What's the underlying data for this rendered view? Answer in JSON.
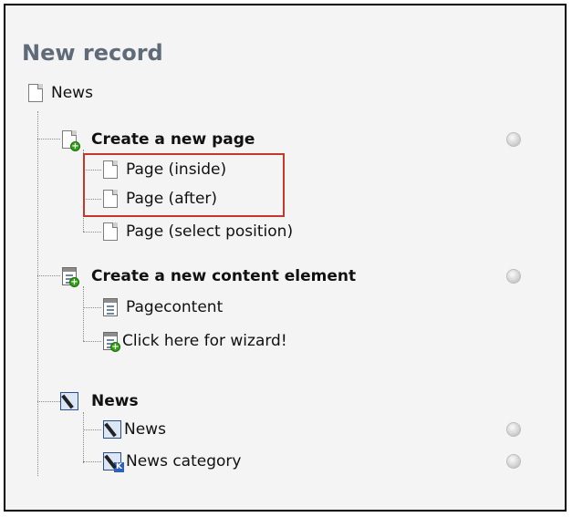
{
  "title": "New record",
  "root": {
    "label": "News",
    "icon": "page-icon"
  },
  "groups": [
    {
      "label": "Create a new page",
      "icon": "new-page-icon",
      "items": [
        {
          "label": "Page (inside)",
          "icon": "page-icon"
        },
        {
          "label": "Page (after)",
          "icon": "page-icon"
        },
        {
          "label": "Page (select position)",
          "icon": "page-icon"
        }
      ]
    },
    {
      "label": "Create a new content element",
      "icon": "new-content-element-icon",
      "items": [
        {
          "label": "Pagecontent",
          "icon": "content-element-icon"
        },
        {
          "label": "Click here for wizard!",
          "icon": "wizard-icon"
        }
      ]
    },
    {
      "label": "News",
      "icon": "news-icon",
      "items": [
        {
          "label": "News",
          "icon": "news-icon"
        },
        {
          "label": "News category",
          "icon": "news-category-icon"
        }
      ]
    }
  ],
  "colors": {
    "title": "#5f6b78",
    "highlight": "#c0392b",
    "background": "#f4f4f4"
  }
}
